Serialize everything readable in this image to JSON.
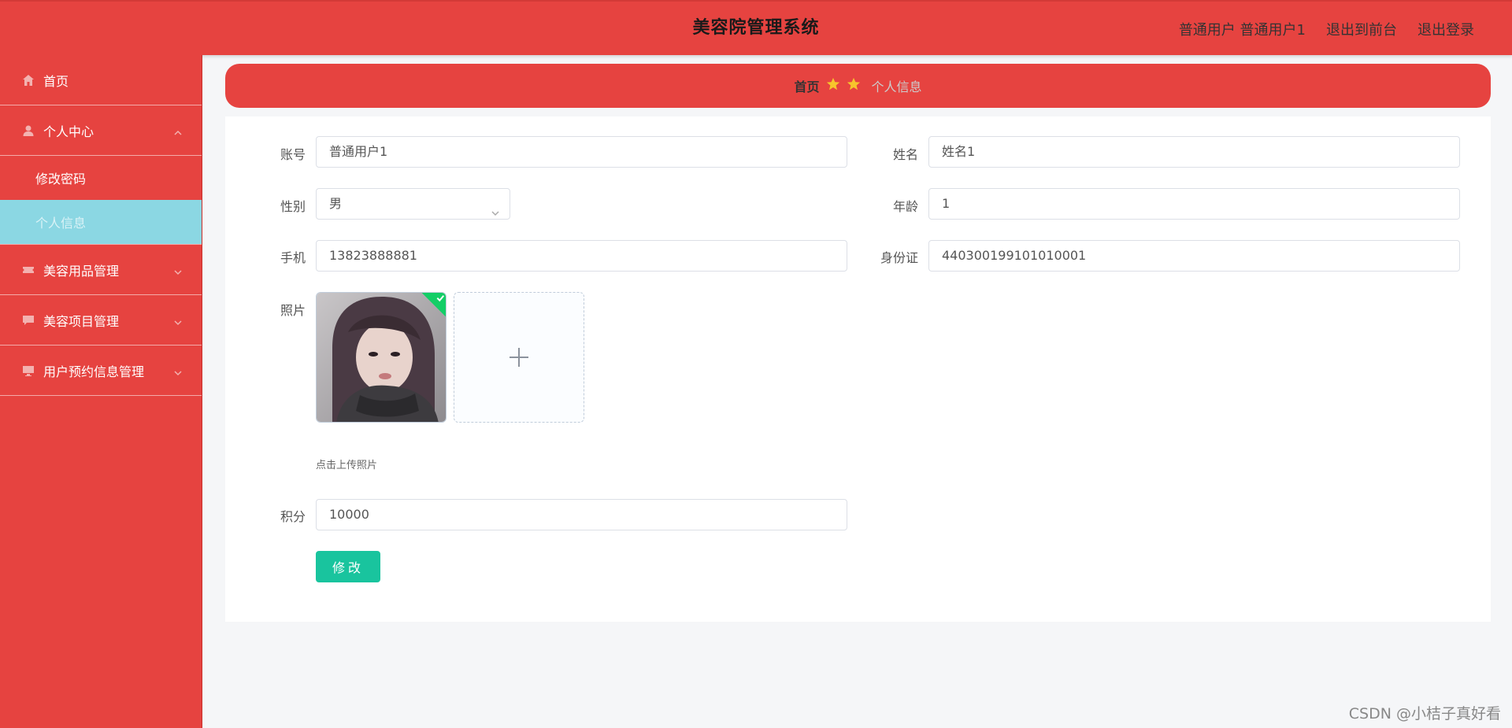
{
  "header": {
    "title": "美容院管理系统",
    "user_role": "普通用户",
    "user_name": "普通用户1",
    "exit_front": "退出到前台",
    "logout": "退出登录"
  },
  "sidebar": {
    "items": [
      {
        "label": "首页",
        "icon": "home-icon"
      },
      {
        "label": "个人中心",
        "icon": "user-icon",
        "expanded": true,
        "children": [
          {
            "label": "修改密码",
            "active": false
          },
          {
            "label": "个人信息",
            "active": true
          }
        ]
      },
      {
        "label": "美容用品管理",
        "icon": "ticket-icon"
      },
      {
        "label": "美容项目管理",
        "icon": "chat-icon"
      },
      {
        "label": "用户预约信息管理",
        "icon": "monitor-icon"
      }
    ]
  },
  "breadcrumb": {
    "home": "首页",
    "current": "个人信息"
  },
  "form": {
    "account_label": "账号",
    "account_value": "普通用户1",
    "name_label": "姓名",
    "name_value": "姓名1",
    "gender_label": "性别",
    "gender_value": "男",
    "age_label": "年龄",
    "age_value": "1",
    "phone_label": "手机",
    "phone_value": "13823888881",
    "id_label": "身份证",
    "id_value": "440300199101010001",
    "photo_label": "照片",
    "upload_tip": "点击上传照片",
    "points_label": "积分",
    "points_value": "10000",
    "submit_label": "修改"
  },
  "watermark": "CSDN @小桔子真好看",
  "colors": {
    "primary": "#e64340",
    "active_menu": "#8bd7e3",
    "button": "#19c49e",
    "star": "#f7c52c"
  }
}
